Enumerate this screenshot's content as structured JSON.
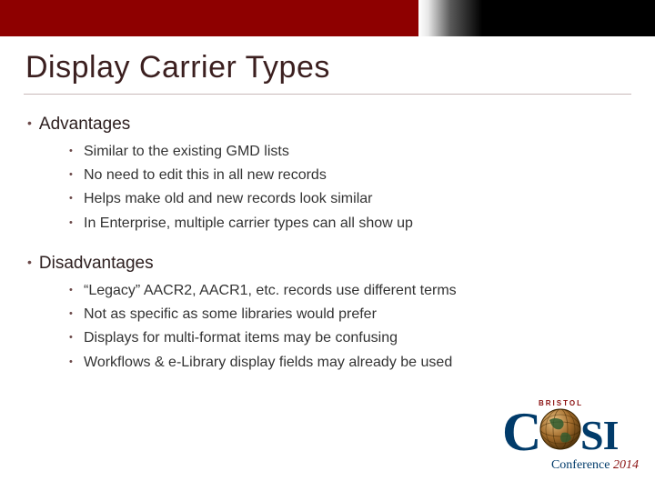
{
  "title": "Display Carrier Types",
  "sections": [
    {
      "heading": "Advantages",
      "items": [
        "Similar to the existing GMD lists",
        "No need to edit this in all new records",
        "Helps make old and new records look similar",
        "In Enterprise, multiple carrier types can all show up"
      ]
    },
    {
      "heading": "Disadvantages",
      "items": [
        "“Legacy” AACR2, AACR1, etc. records use different terms",
        "Not as specific as some libraries would prefer",
        "Displays for multi-format items may be confusing",
        "Workflows & e-Library display fields may already be used"
      ]
    }
  ],
  "logo": {
    "arch_text": "BRISTOL",
    "c": "C",
    "si": "SI",
    "conference": "Conference",
    "year": "2014"
  },
  "colors": {
    "bar_red": "#8e0000",
    "bar_black": "#000000",
    "brand_blue": "#013b6a",
    "brand_red": "#8a1010"
  }
}
